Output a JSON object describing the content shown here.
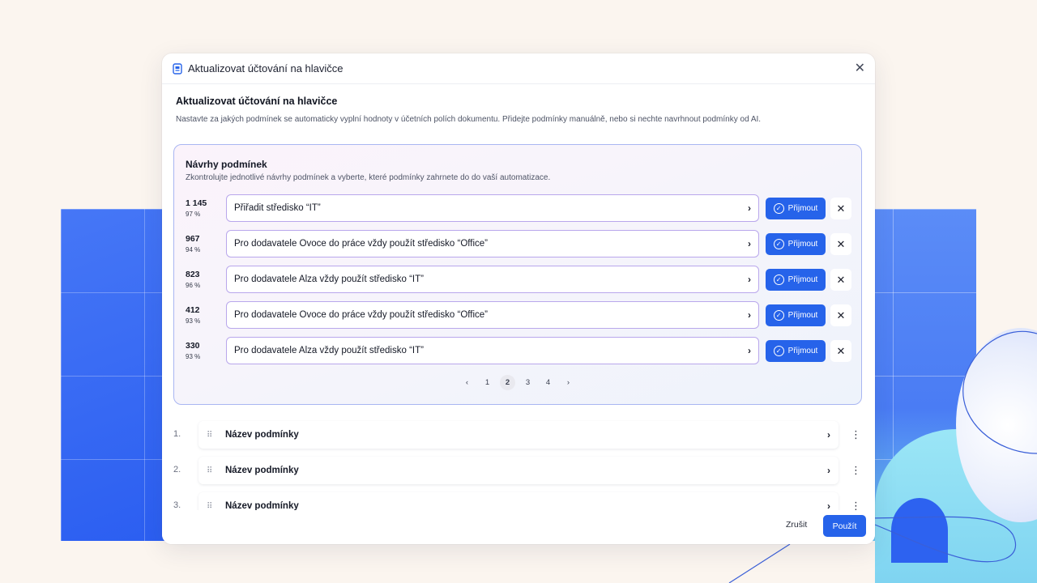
{
  "dialog": {
    "header_title": "Aktualizovat účtování na hlavičce",
    "title": "Aktualizovat účtování na hlavičce",
    "description": "Nastavte za jakých podmínek se automaticky vyplní hodnoty v účetních polích dokumentu. Přidejte podmínky manuálně, nebo si nechte navrhnout podmínky od AI.",
    "close_icon": "close-icon"
  },
  "suggestions": {
    "title": "Návrhy podmínek",
    "description": "Zkontrolujte jednotlivé návrhy podmínek a vyberte, které podmínky zahrnete do do vaší automatizace.",
    "accept_label": "Přijmout",
    "items": [
      {
        "count": "1 145",
        "pct": "97 %",
        "label": "Přiřadit středisko “IT”"
      },
      {
        "count": "967",
        "pct": "94 %",
        "label": "Pro dodavatele Ovoce do práce vždy použít středisko “Office”"
      },
      {
        "count": "823",
        "pct": "96 %",
        "label": "Pro dodavatele Alza vždy použít středisko “IT”"
      },
      {
        "count": "412",
        "pct": "93 %",
        "label": "Pro dodavatele Ovoce do práce vždy použít středisko “Office”"
      },
      {
        "count": "330",
        "pct": "93 %",
        "label": "Pro dodavatele Alza vždy použít středisko “IT”"
      }
    ],
    "pagination": {
      "pages": [
        "1",
        "2",
        "3",
        "4"
      ],
      "current": "2"
    }
  },
  "conditions": [
    {
      "num": "1.",
      "label": "Název podmínky"
    },
    {
      "num": "2.",
      "label": "Název podmínky"
    },
    {
      "num": "3.",
      "label": "Název podmínky"
    }
  ],
  "footer": {
    "cancel_label": "Zrušit",
    "apply_label": "Použít"
  },
  "colors": {
    "accent": "#2663ea",
    "background": "#fbf5ef",
    "grid_blue": "#2f63f2"
  }
}
